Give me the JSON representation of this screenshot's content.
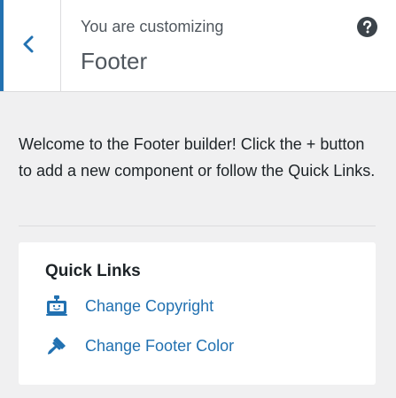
{
  "header": {
    "customizing_label": "You are customizing",
    "section_title": "Footer",
    "back_icon": "chevron-left-icon",
    "help_icon": "question-circle-icon"
  },
  "description": "Welcome to the Footer builder! Click the + button to add a new component or follow the Quick Links.",
  "quick_links": {
    "title": "Quick Links",
    "items": [
      {
        "label": "Change Copyright",
        "icon": "copyright-block-icon"
      },
      {
        "label": "Change Footer Color",
        "icon": "paintbrush-icon"
      }
    ]
  },
  "colors": {
    "accent": "#2271b1",
    "text": "#1d2327",
    "muted_text": "#50575e",
    "panel_bg": "#f0f0f1",
    "card_bg": "#ffffff",
    "border": "#dcdcde"
  }
}
